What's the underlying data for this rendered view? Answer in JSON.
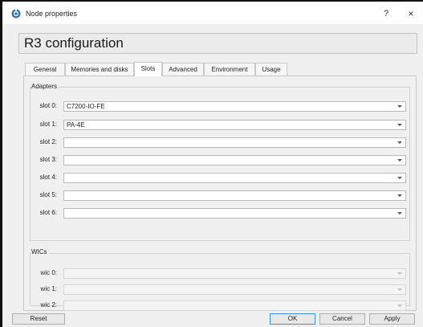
{
  "window": {
    "title": "Node properties",
    "help_glyph": "?",
    "close_glyph": "×"
  },
  "page_title": "R3 configuration",
  "tabs": [
    {
      "label": "General",
      "active": false
    },
    {
      "label": "Memories and disks",
      "active": false
    },
    {
      "label": "Slots",
      "active": true
    },
    {
      "label": "Advanced",
      "active": false
    },
    {
      "label": "Environment",
      "active": false
    },
    {
      "label": "Usage",
      "active": false
    }
  ],
  "adapters": {
    "group_label": "Adapters",
    "slots": [
      {
        "label": "slot 0:",
        "value": "C7200-IO-FE",
        "enabled": true
      },
      {
        "label": "slot 1:",
        "value": "PA-4E",
        "enabled": true
      },
      {
        "label": "slot 2:",
        "value": "",
        "enabled": true
      },
      {
        "label": "slot 3:",
        "value": "",
        "enabled": true
      },
      {
        "label": "slot 4:",
        "value": "",
        "enabled": true
      },
      {
        "label": "slot 5:",
        "value": "",
        "enabled": true
      },
      {
        "label": "slot 6:",
        "value": "",
        "enabled": true
      }
    ]
  },
  "wics": {
    "group_label": "WICs",
    "slots": [
      {
        "label": "wic 0:",
        "value": "",
        "enabled": false
      },
      {
        "label": "wic 1:",
        "value": "",
        "enabled": false
      },
      {
        "label": "wic 2:",
        "value": "",
        "enabled": false
      }
    ]
  },
  "buttons": {
    "reset": "Reset",
    "ok": "OK",
    "cancel": "Cancel",
    "apply": "Apply"
  },
  "colors": {
    "dialog_bg": "#f0f0f0",
    "default_button_border": "#3c8fd8",
    "icon_blue": "#2f6fb4"
  }
}
